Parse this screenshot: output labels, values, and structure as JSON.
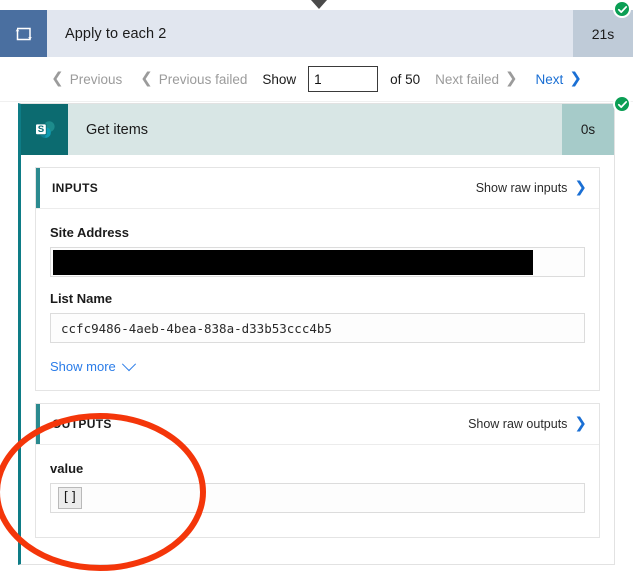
{
  "window": {
    "scroll_caret_icon": "caret-down-icon"
  },
  "foreach": {
    "icon": "loop-foreach-icon",
    "title": "Apply to each 2",
    "duration": "21s",
    "status": "succeeded",
    "status_icon": "check-circle-icon",
    "colors": {
      "header_bg": "#e1e6ef",
      "icon_bg": "#4a6fa0",
      "duration_bg": "#bfcbd8",
      "success": "#0a9e54"
    }
  },
  "pager": {
    "previous_label": "Previous",
    "previous_failed_label": "Previous failed",
    "show_label": "Show",
    "current_page": "1",
    "of_label": "of 50",
    "next_failed_label": "Next failed",
    "next_label": "Next",
    "prev_chevron_icon": "chevron-left-icon",
    "next_chevron_icon": "chevron-right-icon",
    "link_color": "#1a6fd4",
    "disabled_color": "#9b9b9b"
  },
  "action": {
    "connector_icon": "sharepoint-icon",
    "title": "Get items",
    "duration": "0s",
    "status": "succeeded",
    "status_icon": "check-circle-icon",
    "colors": {
      "header_bg": "#d8e6e5",
      "icon_bg": "#0c6b70",
      "duration_bg": "#a6cbc9",
      "accent": "#0e7c86"
    }
  },
  "inputs": {
    "title": "INPUTS",
    "raw_link_label": "Show raw inputs",
    "raw_link_icon": "chevron-right-icon",
    "fields": [
      {
        "label": "Site Address",
        "value": "",
        "redacted": true
      },
      {
        "label": "List Name",
        "value": "ccfc9486-4aeb-4bea-838a-d33b53ccc4b5",
        "redacted": false
      }
    ],
    "show_more_label": "Show more",
    "show_more_icon": "chevron-down-icon"
  },
  "outputs": {
    "title": "OUTPUTS",
    "raw_link_label": "Show raw outputs",
    "raw_link_icon": "chevron-right-icon",
    "value_label": "value",
    "value_content": "[]"
  },
  "annotation": {
    "shape": "ellipse",
    "color": "#f4360a",
    "target": "outputs-value"
  }
}
